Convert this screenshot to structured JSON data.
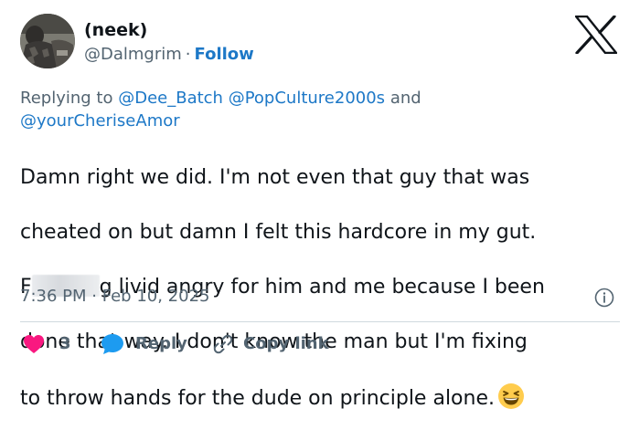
{
  "user": {
    "display_name": "(neek)",
    "handle": "@Dalmgrim",
    "separator": "·",
    "follow_label": "Follow"
  },
  "reply": {
    "prefix": "Replying to",
    "mention_1": "@Dee_Batch",
    "mention_2": "@PopCulture2000s",
    "conjunction": "and",
    "mention_3": "@yourCheriseAmor"
  },
  "tweet": {
    "line1": "Damn right we did. I'm not even that guy that was",
    "line2": "cheated on but damn I felt this hardcore in my gut.",
    "line3_start": "F",
    "line3_end": "g livid angry for him and me because I been",
    "line4": "done that way. I don't know the man but I'm fixing",
    "line5": "to throw hands for the dude on principle alone.",
    "emoji": "grinning-squinting-face"
  },
  "meta": {
    "time": "7:36 PM",
    "separator": "·",
    "date": "Feb 10, 2025"
  },
  "actions": {
    "like_count": "3",
    "reply_label": "Reply",
    "copy_label": "Copy link"
  },
  "colors": {
    "link": "#1d78c7",
    "secondary_text": "#536471",
    "like": "#f91880",
    "reply_bubble": "#1d9bf0"
  }
}
